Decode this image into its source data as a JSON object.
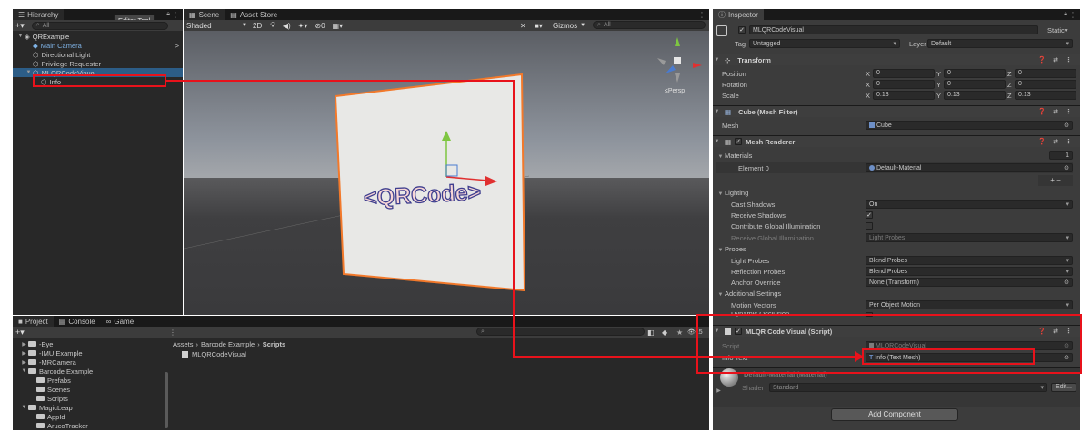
{
  "hierarchy": {
    "tab": "Hierarchy",
    "tooltip": "Editor Tool",
    "add_symbol": "+▾",
    "search_placeholder": "All",
    "items": [
      {
        "label": "QRExample",
        "indent": 0,
        "expanded": true,
        "icon": "scene-icon",
        "style": "scene"
      },
      {
        "label": "Main Camera",
        "indent": 1,
        "icon": "camera-object-icon",
        "style": "prefab",
        "chevron": ">"
      },
      {
        "label": "Directional Light",
        "indent": 1,
        "icon": "gameobject-icon",
        "style": "normal"
      },
      {
        "label": "Privilege Requester",
        "indent": 1,
        "icon": "gameobject-icon",
        "style": "normal"
      },
      {
        "label": "MLQRCodeVisual",
        "indent": 1,
        "expanded": true,
        "icon": "gameobject-icon",
        "style": "selected"
      },
      {
        "label": "Info",
        "indent": 2,
        "icon": "gameobject-icon",
        "style": "normal"
      }
    ]
  },
  "scene": {
    "tabs": [
      "Scene",
      "Asset Store"
    ],
    "shading": "Shaded",
    "mode_2d": "2D",
    "gizmos": "Gizmos",
    "search_placeholder": "All",
    "persp_label": "≤Persp",
    "qrcode_text": "<QRCode>",
    "colors": {
      "sky": "#8e949d",
      "ground": "#3f3f41",
      "quad": "#e8e8e6",
      "outline": "#f2792b",
      "text": "#f7d6d6",
      "text_stroke": "#3f3f8f"
    }
  },
  "project": {
    "tabs": [
      "Project",
      "Console",
      "Game"
    ],
    "add_symbol": "+▾",
    "slider_count": "15",
    "breadcrumb": [
      "Assets",
      "Barcode Example",
      "Scripts"
    ],
    "tree": [
      {
        "label": "-Eye",
        "indent": 1,
        "expanded": false
      },
      {
        "label": "-IMU Example",
        "indent": 1,
        "expanded": false
      },
      {
        "label": "-MRCamera",
        "indent": 1,
        "expanded": false
      },
      {
        "label": "Barcode Example",
        "indent": 1,
        "expanded": true
      },
      {
        "label": "Prefabs",
        "indent": 2,
        "expanded": null
      },
      {
        "label": "Scenes",
        "indent": 2,
        "expanded": null
      },
      {
        "label": "Scripts",
        "indent": 2,
        "expanded": null
      },
      {
        "label": "MagicLeap",
        "indent": 1,
        "expanded": true
      },
      {
        "label": "AppId",
        "indent": 2,
        "expanded": null
      },
      {
        "label": "ArucoTracker",
        "indent": 2,
        "expanded": null
      }
    ],
    "assets": [
      {
        "label": "MLQRCodeVisual",
        "icon": "csharp-script-icon"
      }
    ]
  },
  "inspector": {
    "tab": "Inspector",
    "object_name": "MLQRCodeVisual",
    "static_label": "Static",
    "tag_label": "Tag",
    "tag_value": "Untagged",
    "layer_label": "Layer",
    "layer_value": "Default",
    "transform": {
      "title": "Transform",
      "position_label": "Position",
      "rotation_label": "Rotation",
      "scale_label": "Scale",
      "axes": [
        "X",
        "Y",
        "Z"
      ],
      "position": [
        "0",
        "0",
        "0"
      ],
      "rotation": [
        "0",
        "0",
        "0"
      ],
      "scale": [
        "0.13",
        "0.13",
        "0.13"
      ]
    },
    "mesh_filter": {
      "title": "Cube (Mesh Filter)",
      "mesh_label": "Mesh",
      "mesh_value": "Cube"
    },
    "mesh_renderer": {
      "title": "Mesh Renderer",
      "materials_label": "Materials",
      "materials_count": "1",
      "element0_label": "Element 0",
      "element0_value": "Default-Material",
      "plus_minus": "+  −",
      "lighting_label": "Lighting",
      "cast_shadows_label": "Cast Shadows",
      "cast_shadows_value": "On",
      "receive_shadows_label": "Receive Shadows",
      "contribute_gi_label": "Contribute Global Illumination",
      "receive_gi_label": "Receive Global Illumination",
      "receive_gi_value": "Light Probes",
      "probes_label": "Probes",
      "light_probes_label": "Light Probes",
      "light_probes_value": "Blend Probes",
      "reflection_probes_label": "Reflection Probes",
      "reflection_probes_value": "Blend Probes",
      "anchor_override_label": "Anchor Override",
      "anchor_override_value": "None (Transform)",
      "additional_label": "Additional Settings",
      "motion_vectors_label": "Motion Vectors",
      "motion_vectors_value": "Per Object Motion",
      "dynamic_occlusion_label": "Dynamic Occlusion"
    },
    "script_component": {
      "title": "MLQR Code Visual (Script)",
      "script_label": "Script",
      "script_value": "MLQRCodeVisual",
      "info_text_label": "Info Text",
      "info_text_value": "Info (Text Mesh)"
    },
    "material": {
      "name": "Default-Material (Material)",
      "shader_label": "Shader",
      "shader_value": "Standard",
      "edit_label": "Edit..."
    },
    "add_component": "Add Component"
  },
  "annotation_color": "#e8121b"
}
